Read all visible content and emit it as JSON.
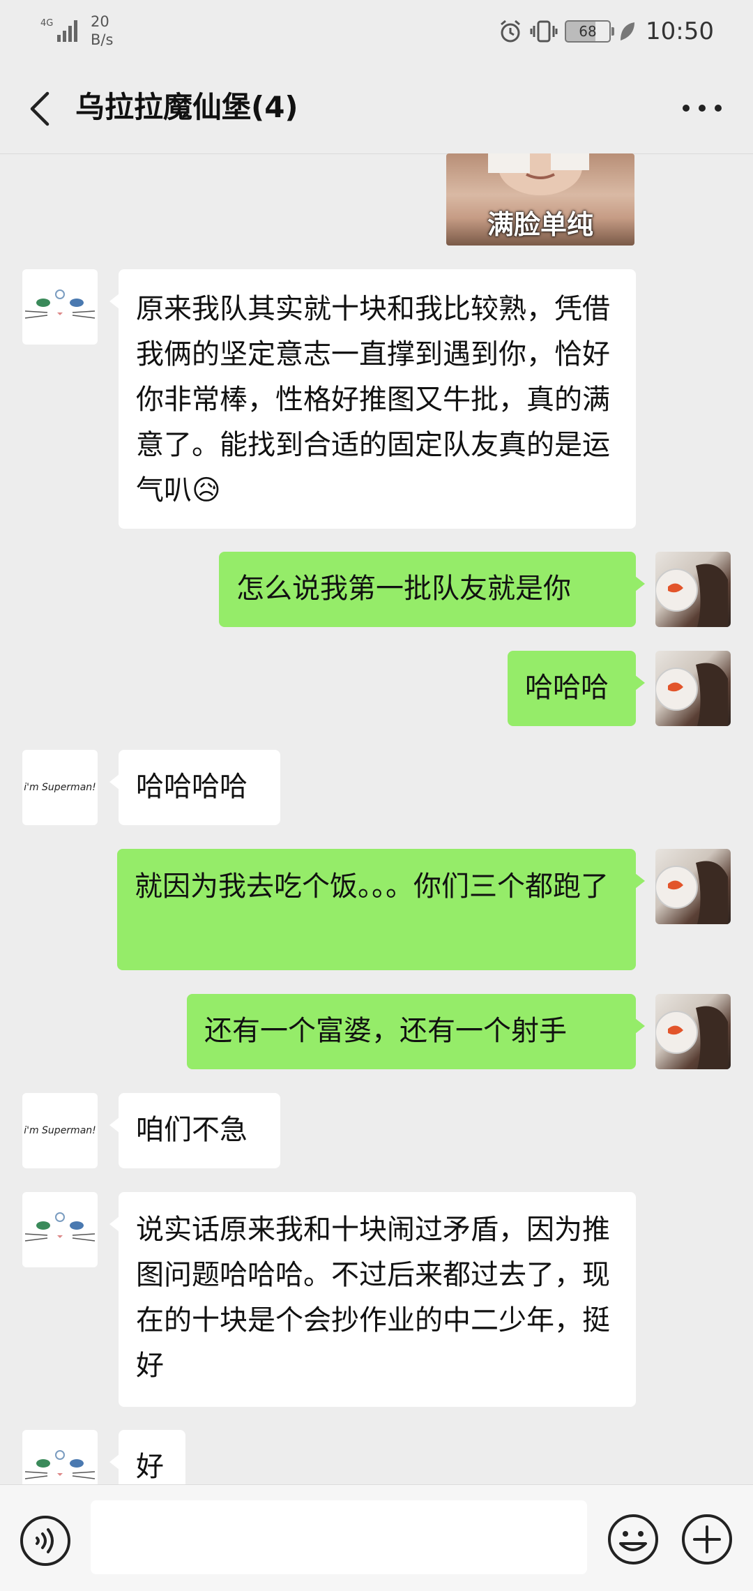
{
  "status_bar": {
    "network": "4G",
    "speed_value": "20",
    "speed_unit": "B/s",
    "battery": "68",
    "time": "10:50"
  },
  "header": {
    "title": "乌拉拉魔仙堡(4)"
  },
  "sticker": {
    "caption": "满脸单纯"
  },
  "messages": [
    {
      "side": "left",
      "sender": "cat",
      "text": "原来我队其实就十块和我比较熟，凭借我俩的坚定意志一直撑到遇到你，恰好你非常棒，性格好推图又牛批，真的满意了。能找到合适的固定队友真的是运气叭😥"
    },
    {
      "side": "right",
      "sender": "me",
      "text": "怎么说我第一批队友就是你"
    },
    {
      "side": "right",
      "sender": "me",
      "text": "哈哈哈"
    },
    {
      "side": "left",
      "sender": "super",
      "text": "哈哈哈哈"
    },
    {
      "side": "right",
      "sender": "me",
      "text": "就因为我去吃个饭。。。你们三个都跑了"
    },
    {
      "side": "right",
      "sender": "me",
      "text": "还有一个富婆，还有一个射手"
    },
    {
      "side": "left",
      "sender": "super",
      "text": "咱们不急"
    },
    {
      "side": "left",
      "sender": "cat",
      "text": "说实话原来我和十块闹过矛盾，因为推图问题哈哈哈。不过后来都过去了，现在的十块是个会抄作业的中二少年，挺好"
    },
    {
      "side": "left",
      "sender": "cat",
      "text": "好"
    }
  ],
  "avatars": {
    "super_text": "i'm Superman!"
  },
  "input": {
    "placeholder": ""
  }
}
